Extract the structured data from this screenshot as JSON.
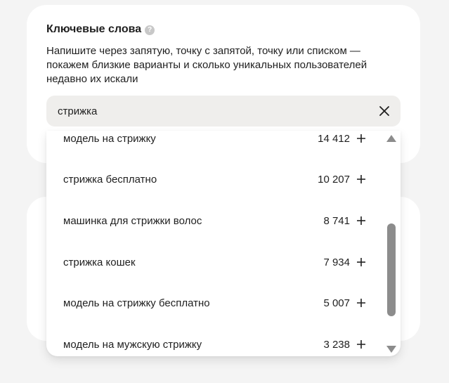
{
  "keywords_card": {
    "title": "Ключевые слова",
    "help_icon": "question-mark-icon",
    "description": "Напишите через запятую, точку с запятой, точку или списком — покажем близкие варианты и сколько уникальных пользователей недавно их искали",
    "search_value": "стрижка",
    "clear_icon": "close-icon"
  },
  "suggestions": [
    {
      "label": "модель на стрижку",
      "count": "14 412"
    },
    {
      "label": "стрижка бесплатно",
      "count": "10 207"
    },
    {
      "label": "машинка для стрижки волос",
      "count": "8 741"
    },
    {
      "label": "стрижка кошек",
      "count": "7 934"
    },
    {
      "label": "модель на стрижку бесплатно",
      "count": "5 007"
    },
    {
      "label": "модель на мужскую стрижку",
      "count": "3 238"
    }
  ],
  "icons": {
    "add": "plus-icon",
    "scroll_up": "scroll-up-arrow-icon",
    "scroll_down": "scroll-down-arrow-icon"
  },
  "colors": {
    "page_background": "#f4f4f4",
    "card_background": "#ffffff",
    "input_background": "#efeeec",
    "text": "#1f1f1f",
    "scrollbar": "#8c8c8c"
  }
}
